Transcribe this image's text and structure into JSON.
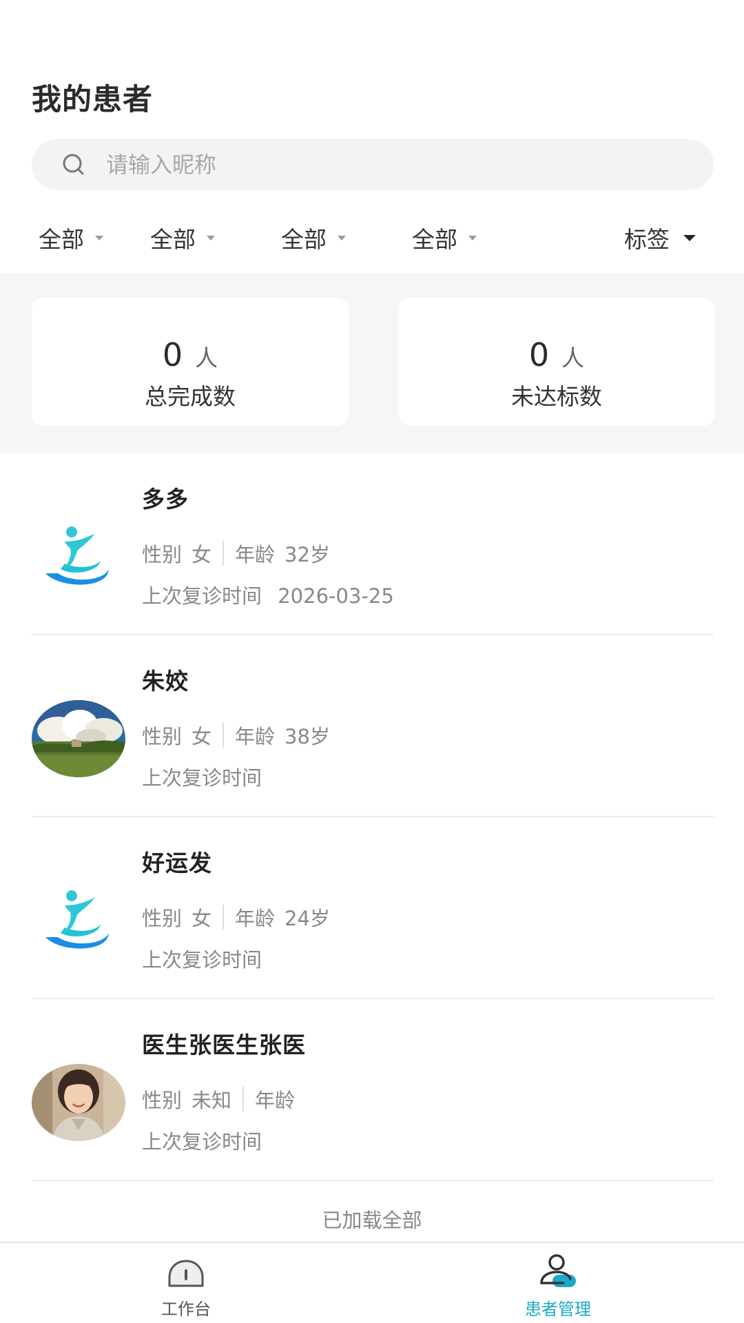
{
  "header": {
    "title": "我的患者"
  },
  "search": {
    "placeholder": "请输入昵称",
    "value": ""
  },
  "filters": [
    {
      "label": "全部"
    },
    {
      "label": "全部"
    },
    {
      "label": "全部"
    },
    {
      "label": "全部"
    },
    {
      "label": "标签"
    }
  ],
  "stats": {
    "completed": {
      "value": "0",
      "unit": "人",
      "label": "总完成数"
    },
    "not_reached": {
      "value": "0",
      "unit": "人",
      "label": "未达标数"
    }
  },
  "patients": [
    {
      "name": "多多",
      "gender_label": "性别",
      "gender": "女",
      "age_label": "年龄",
      "age": "32岁",
      "visit_label": "上次复诊时间",
      "visit_date": "2026-03-25",
      "avatar": "app-logo"
    },
    {
      "name": "朱姣",
      "gender_label": "性别",
      "gender": "女",
      "age_label": "年龄",
      "age": "38岁",
      "visit_label": "上次复诊时间",
      "visit_date": "",
      "avatar": "landscape-photo"
    },
    {
      "name": "好运发",
      "gender_label": "性别",
      "gender": "女",
      "age_label": "年龄",
      "age": "24岁",
      "visit_label": "上次复诊时间",
      "visit_date": "",
      "avatar": "app-logo"
    },
    {
      "name": "医生张医生张医",
      "gender_label": "性别",
      "gender": "未知",
      "age_label": "年龄",
      "age": "",
      "visit_label": "上次复诊时间",
      "visit_date": "",
      "avatar": "person-photo"
    }
  ],
  "list_footer": "已加载全部",
  "nav": {
    "workbench": {
      "label": "工作台",
      "icon": "workbench-icon"
    },
    "patients": {
      "label": "患者管理",
      "icon": "patient-management-icon",
      "active": true
    }
  },
  "colors": {
    "accent": "#1aa9c9",
    "band_bg": "#f6f6f6",
    "search_bg": "#f3f3f3"
  }
}
